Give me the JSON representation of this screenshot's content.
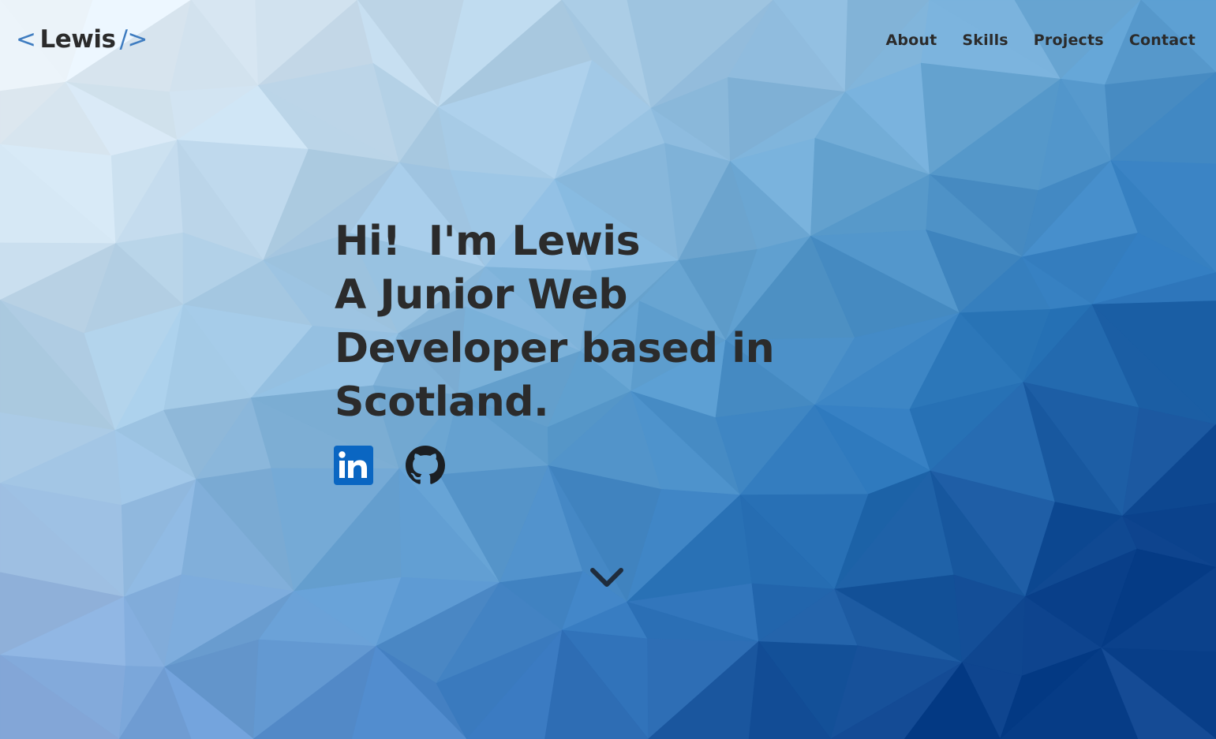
{
  "logo": {
    "open_bracket": "<",
    "name": "Lewis",
    "close_bracket": "/>"
  },
  "nav": {
    "items": [
      "About",
      "Skills",
      "Projects",
      "Contact"
    ]
  },
  "hero": {
    "lines": [
      "Hi!  I'm Lewis",
      "A Junior Web",
      "Developer based in",
      "Scotland."
    ]
  },
  "socials": [
    {
      "icon": "linkedin-icon",
      "label": "LinkedIn"
    },
    {
      "icon": "github-icon",
      "label": "GitHub"
    }
  ],
  "scroll_icon": "chevron-down-icon",
  "colors": {
    "accent": "#3e7cc0",
    "text": "#2b2b2b",
    "linkedin": "#0a66c2",
    "github": "#1b1f23"
  }
}
